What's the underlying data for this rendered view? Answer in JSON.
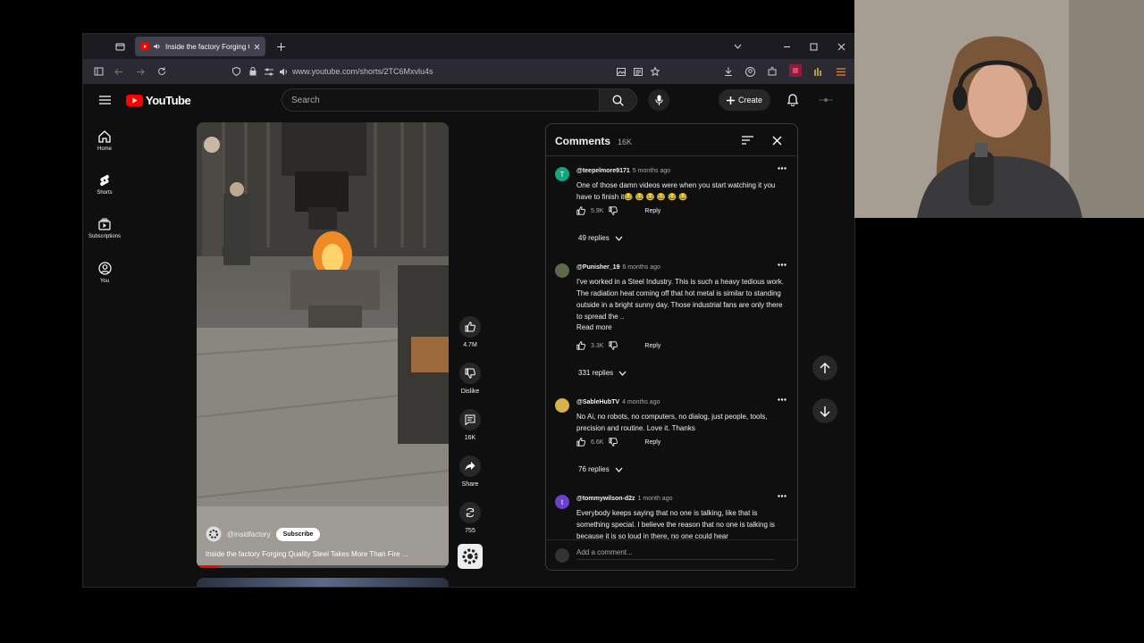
{
  "browser": {
    "tab_title": "Inside the factory Forging Q",
    "url": "www.youtube.com/shorts/2TC6Mxvlu4s"
  },
  "youtube": {
    "logo_text": "YouTube",
    "search_placeholder": "Search",
    "create_label": "Create",
    "sidebar": [
      {
        "label": "Home",
        "icon": "home-icon"
      },
      {
        "label": "Shorts",
        "icon": "shorts-icon"
      },
      {
        "label": "Subscriptions",
        "icon": "subscriptions-icon"
      },
      {
        "label": "You",
        "icon": "you-icon"
      }
    ]
  },
  "video": {
    "channel": "@insidfactory",
    "subscribe_label": "Subscribe",
    "title": "Inside the factory Forging Quality Steel Takes More Than Fire ...",
    "actions": {
      "like_count": "4.7M",
      "dislike_label": "Dislike",
      "comments_count": "16K",
      "share_label": "Share",
      "remix_count": "755"
    }
  },
  "comments": {
    "title": "Comments",
    "count": "16K",
    "add_placeholder": "Add a comment...",
    "items": [
      {
        "user": "@teepelmore9171",
        "time": "5 months ago",
        "text": "One of those damn videos were when you start watching it you have to finish it😂 😂 😂 😂 😂 😂",
        "likes": "5.9K",
        "reply_label": "Reply",
        "replies": "49 replies",
        "avatar_letter": "T",
        "avatar_color": "#11a683"
      },
      {
        "user": "@Punisher_19",
        "time": "6 months ago",
        "text": "I've worked in a Steel Industry. This is such a heavy tedious work. The radiation heat coming off that hot metal is similar to standing outside in a bright sunny day. Those industrial fans are only there to spread the ..",
        "read_more": "Read more",
        "likes": "3.3K",
        "reply_label": "Reply",
        "replies": "331 replies",
        "avatar_letter": "",
        "avatar_color": "#5a6a4a"
      },
      {
        "user": "@SableHubTV",
        "time": "4 months ago",
        "text": "No Ai, no robots, no computers, no dialog, just people, tools, precision and routine. Love it. Thanks",
        "likes": "6.6K",
        "reply_label": "Reply",
        "replies": "76 replies",
        "avatar_letter": "",
        "avatar_color": "#d9b24a"
      },
      {
        "user": "@tommywilson-d2z",
        "time": "1 month ago",
        "text": "Everybody keeps saying that no one is talking, like that is something special. I believe the reason that no one is talking is because it is so loud in there, no one could hear",
        "avatar_letter": "t",
        "avatar_color": "#6a3fd1"
      }
    ]
  },
  "colors": {
    "youtube_red": "#ff0000",
    "background": "#0f0f0f"
  }
}
